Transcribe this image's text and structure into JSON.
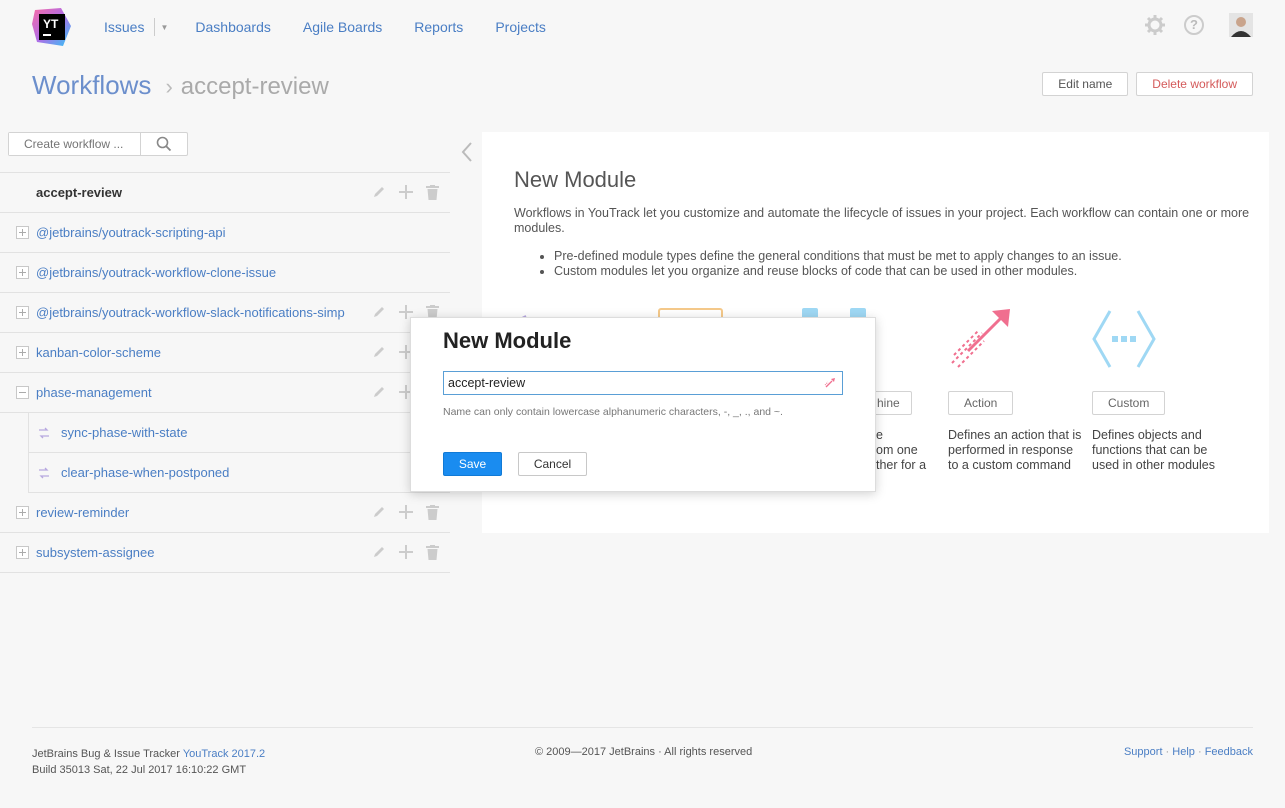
{
  "header": {
    "logo_text": "YT",
    "nav": [
      {
        "label": "Issues"
      },
      {
        "label": "Dashboards"
      },
      {
        "label": "Agile Boards"
      },
      {
        "label": "Reports"
      },
      {
        "label": "Projects"
      }
    ],
    "help_glyph": "?"
  },
  "title_bar": {
    "title": "Workflows",
    "separator": "›",
    "subtitle": "accept-review",
    "edit_name": "Edit name",
    "delete_workflow": "Delete workflow"
  },
  "sidebar": {
    "create_placeholder": "Create workflow ...",
    "workflows": [
      {
        "name": "accept-review"
      },
      {
        "name": "@jetbrains/youtrack-scripting-api"
      },
      {
        "name": "@jetbrains/youtrack-workflow-clone-issue"
      },
      {
        "name": "@jetbrains/youtrack-workflow-slack-notifications-simp"
      },
      {
        "name": "kanban-color-scheme"
      },
      {
        "name": "phase-management"
      },
      {
        "name": "sync-phase-with-state"
      },
      {
        "name": "clear-phase-when-postponed"
      },
      {
        "name": "review-reminder"
      },
      {
        "name": "subsystem-assignee"
      }
    ]
  },
  "panel": {
    "title": "New Module",
    "description": "Workflows in YouTrack let you customize and automate the lifecycle of issues in your project. Each workflow can contain one or more modules.",
    "bullets": [
      "Pre-defined module types define the general conditions that must be met to apply changes to an issue.",
      "Custom modules let you organize and reuse blocks of code that can be used in other modules."
    ],
    "module_types": [
      {
        "button": "hine",
        "desc": "e\nom one\nther for a"
      },
      {
        "button": "Action",
        "desc": "Defines an action that is performed in response to a custom command"
      },
      {
        "button": "Custom",
        "desc": "Defines objects and functions that can be used in other modules"
      }
    ]
  },
  "dialog": {
    "title": "New Module",
    "input_value": "accept-review",
    "hint": "Name can only contain lowercase alphanumeric characters, -, _, ., and ~.",
    "save": "Save",
    "cancel": "Cancel"
  },
  "footer": {
    "product_prefix": "JetBrains Bug & Issue Tracker ",
    "product_link": "YouTrack 2017.2",
    "build": "Build 35013 Sat, 22 Jul 2017 16:10:22 GMT",
    "copyright": "© 2009—2017 JetBrains · All rights reserved",
    "links": [
      "Support",
      "Help",
      "Feedback"
    ]
  },
  "colors": {
    "link": "#4a7ec4",
    "primary_button": "#1a8cf0",
    "danger_text": "#d45a5a",
    "action_icon": "#f06f8f",
    "custom_icon": "#9fd8f4"
  }
}
